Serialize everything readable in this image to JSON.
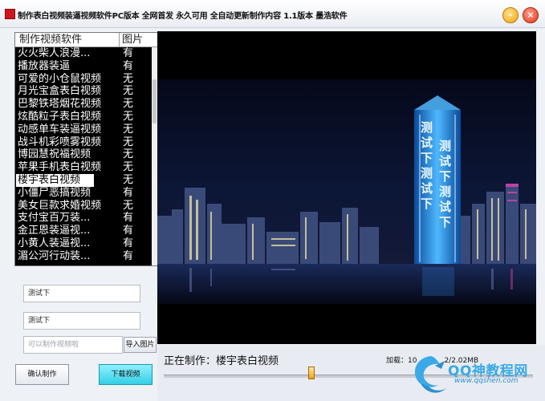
{
  "window": {
    "title": "制作表白视频装逼视频软件PC版本 全网首发  永久可用 全自动更新制作内容 1.1版本 墨浩软件",
    "minimize_glyph": "–",
    "close_glyph": "×"
  },
  "list": {
    "col_name": "制作视频软件",
    "col_pic": "图片",
    "rows": [
      {
        "name": "火火柴人浪漫...",
        "pic": "有"
      },
      {
        "name": "播放器装逼",
        "pic": "有"
      },
      {
        "name": "可爱的小仓鼠视频",
        "pic": "无"
      },
      {
        "name": "月光宝盒表白视频",
        "pic": "无"
      },
      {
        "name": "巴黎铁塔烟花视频",
        "pic": "无"
      },
      {
        "name": "炫酷粒子表白视频",
        "pic": "无"
      },
      {
        "name": "动感单车装逼视频",
        "pic": "无"
      },
      {
        "name": "战斗机彩喷雾视频",
        "pic": "无"
      },
      {
        "name": "博园慧祝福视频",
        "pic": "无"
      },
      {
        "name": "苹果手机表白视频",
        "pic": "无"
      },
      {
        "name": "楼宇表白视频",
        "pic": "无"
      },
      {
        "name": "小僵尸恶搞视频",
        "pic": "有"
      },
      {
        "name": "美女巨款求婚视频",
        "pic": "无"
      },
      {
        "name": "支付宝百万装...",
        "pic": "有"
      },
      {
        "name": "金正恩装逼视...",
        "pic": "有"
      },
      {
        "name": "小黄人装逼视...",
        "pic": "有"
      },
      {
        "name": "湄公河行动装...",
        "pic": "有"
      }
    ],
    "selected_index": 10
  },
  "form": {
    "input1_value": "测试下",
    "input2_value": "测试下",
    "image_input_placeholder": "可以制作视频啦",
    "import_button": "导入图片",
    "confirm_button": "确认制作",
    "download_button": "下载视频"
  },
  "video": {
    "tower_text": "测试下测试下"
  },
  "status": {
    "label": "正在制作：楼宇表白视频",
    "speed_text": "加载：10",
    "speed_tail": "2/2.02MB",
    "progress": 0.4
  },
  "watermark": {
    "title": "QQ神教程网",
    "url": "www.qqshen.com"
  },
  "colors": {
    "list_bg": "#000000",
    "download_button": "#33cfe6",
    "tower_glow": "#4fb8ff",
    "close_button": "#e2381a",
    "minimize_button": "#f2a40c"
  }
}
